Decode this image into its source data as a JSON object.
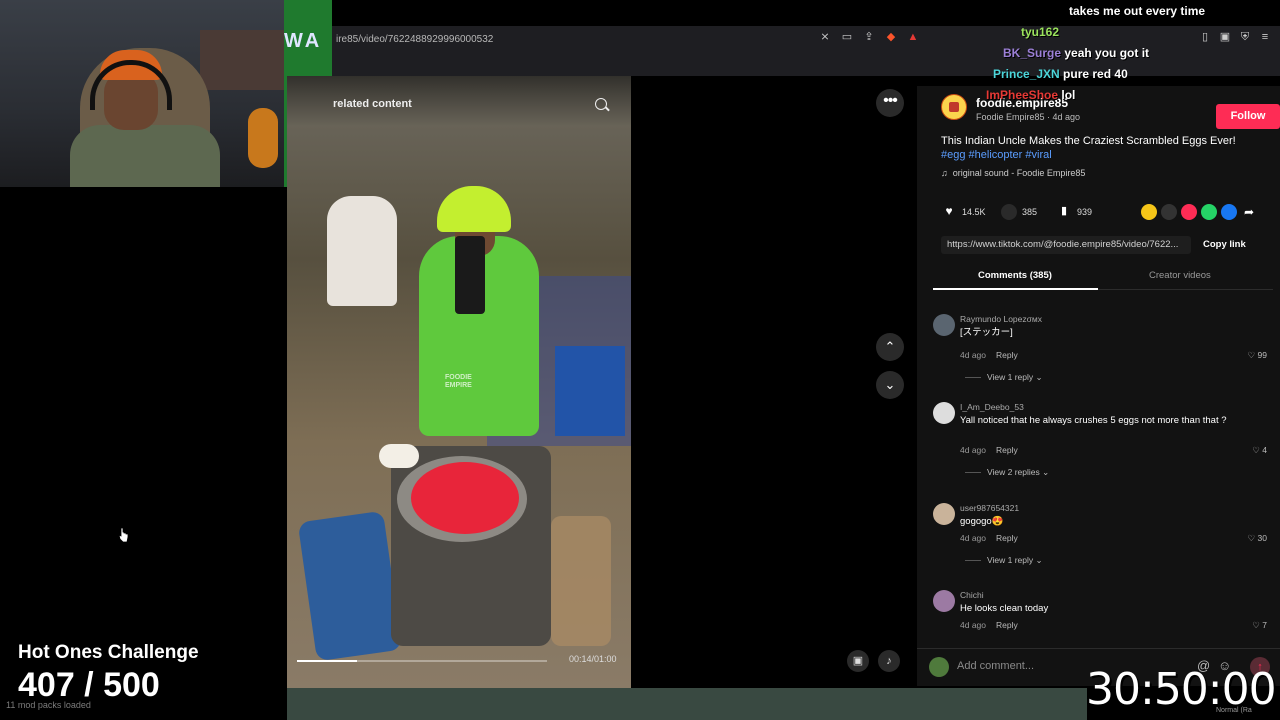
{
  "browser": {
    "url": "ire85/video/7622488929996000532"
  },
  "overlay": {
    "challenge_title": "Hot Ones Challenge",
    "counter": "407 / 500",
    "loaded_text": "11 mod packs loaded",
    "timer": "30:50:00",
    "normal_tag": "Normal (Ra"
  },
  "chat": [
    {
      "user": "",
      "message": "takes me out every time",
      "color": "#ffffff"
    },
    {
      "user": "tyu162",
      "message": "",
      "color": "#9be35d"
    },
    {
      "user": "BK_Surge",
      "message": "yeah you got it",
      "color": "#9b7fd6"
    },
    {
      "user": "Prince_JXN",
      "message": "pure red 40",
      "color": "#4cd5d9"
    },
    {
      "user": "ImPheeShoe",
      "message": "lol",
      "color": "#e53935"
    }
  ],
  "video": {
    "related_label": "related content",
    "time": "00:14/01:00",
    "progress_fraction": 0.24,
    "watermark": "FOODIE\nEMPIRE"
  },
  "panel": {
    "author": {
      "name": "foodie.empire85",
      "sub": "Foodie Empire85 · 4d ago"
    },
    "follow_label": "Follow",
    "caption": "This Indian Uncle Makes the Craziest Scrambled Eggs Ever!",
    "hashtags": "#egg #helicopter #viral",
    "music": "original sound - Foodie Empire85",
    "stats": {
      "likes": "14.5K",
      "comments": "385",
      "saves": "939"
    },
    "link": "https://www.tiktok.com/@foodie.empire85/video/7622...",
    "copy_link": "Copy link",
    "tabs": {
      "comments": "Comments (385)",
      "creator": "Creator videos"
    },
    "comments": [
      {
        "user": "Raymundo Lopezσмx",
        "text": "[ステッカー]",
        "date": "4d ago",
        "reply": "Reply",
        "likes": "99",
        "view_replies": "View 1 reply"
      },
      {
        "user": "I_Am_Deebo_53",
        "text": "Yall noticed that he always crushes 5 eggs not more than that ?",
        "date": "4d ago",
        "reply": "Reply",
        "likes": "4",
        "view_replies": "View 2 replies"
      },
      {
        "user": "user987654321",
        "text": "gogogo😍",
        "date": "4d ago",
        "reply": "Reply",
        "likes": "30",
        "view_replies": "View 1 reply"
      },
      {
        "user": "Chichi",
        "text": "He looks clean today",
        "date": "4d ago",
        "reply": "Reply",
        "likes": "7",
        "view_replies": ""
      }
    ],
    "add_comment_placeholder": "Add comment..."
  },
  "colors": {
    "accent": "#fe2c55",
    "hashtag": "#5b9dff",
    "panel_bg": "#121212"
  },
  "icons": [
    "search-icon",
    "more-icon",
    "chevron-up-icon",
    "chevron-down-icon",
    "volume-icon",
    "heart-icon",
    "comment-icon",
    "bookmark-icon",
    "share-icon",
    "music-icon",
    "at-icon",
    "emoji-icon",
    "send-icon"
  ]
}
